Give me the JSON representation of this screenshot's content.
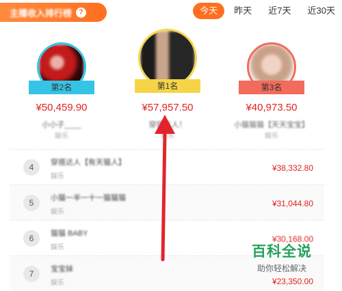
{
  "header": {
    "title": "主播收入排行榜",
    "help_icon": "?",
    "tabs": [
      {
        "label": "今天",
        "active": true
      },
      {
        "label": "昨天",
        "active": false
      },
      {
        "label": "近7天",
        "active": false
      },
      {
        "label": "近30天",
        "active": false
      }
    ]
  },
  "podium": {
    "second": {
      "rank_label": "第2名",
      "amount": "¥50,459.90",
      "nickname": "小小子____",
      "category": "娱乐"
    },
    "first": {
      "rank_label": "第1名",
      "amount": "¥57,957.50",
      "nickname": "穿搭达人！",
      "category": "娱乐"
    },
    "third": {
      "rank_label": "第3名",
      "amount": "¥40,973.50",
      "nickname": "小猫猫猫【天天宝宝】",
      "category": "娱乐"
    }
  },
  "list": [
    {
      "rank": "4",
      "name": "穿搭达人【有天猫人】",
      "category": "娱乐",
      "amount": "¥38,332.80"
    },
    {
      "rank": "5",
      "name": "小猫一半一十一猫猫猫",
      "category": "娱乐",
      "amount": "¥31,044.80"
    },
    {
      "rank": "6",
      "name": "猫猫 BABY",
      "category": "娱乐",
      "amount": "¥30,168.00"
    },
    {
      "rank": "7",
      "name": "宝宝妹",
      "category": "娱乐",
      "amount": "¥23,350.00"
    }
  ],
  "watermark": {
    "title": "百科全说",
    "subtitle": "助你轻松解决"
  },
  "colors": {
    "accent": "#ff6f1f",
    "amount": "#e02020",
    "gold": "#f5d547",
    "silver": "#35c4e6",
    "bronze": "#f26b5b",
    "arrow": "#e3242b"
  }
}
